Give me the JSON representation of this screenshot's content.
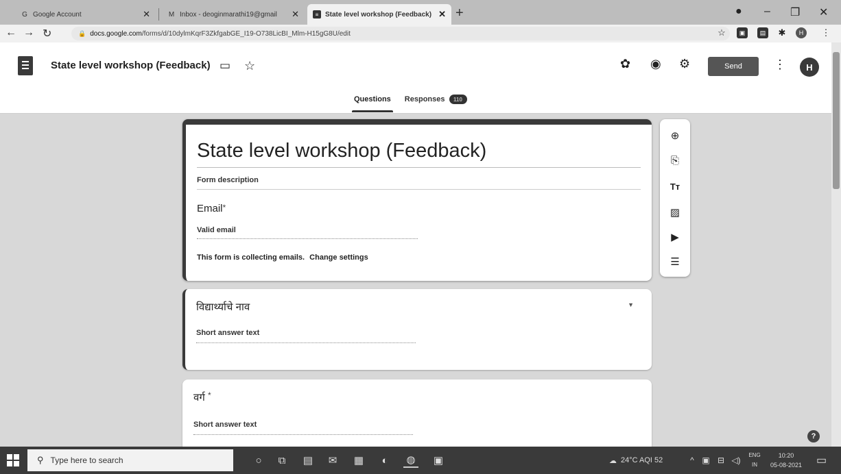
{
  "browser": {
    "tabs": [
      {
        "title": "Google Account",
        "favicon": "G"
      },
      {
        "title": "Inbox - deoginmarathi19@gmail",
        "favicon": "M"
      },
      {
        "title": "State level workshop (Feedback)",
        "favicon": "≡"
      }
    ],
    "url_host": "docs.google.com",
    "url_path": "/forms/d/10dylmKqrF3ZkfgabGE_I19-O738LicBI_Mlm-H15gG8U/edit",
    "profile_initial": "H"
  },
  "forms_header": {
    "title": "State level workshop (Feedback)",
    "send_label": "Send",
    "avatar_initial": "H",
    "tab_questions": "Questions",
    "tab_responses": "Responses",
    "responses_count": "110"
  },
  "form": {
    "title": "State level workshop (Feedback)",
    "description_placeholder": "Form description",
    "email_question": "Email",
    "required_mark": "*",
    "email_hint": "Valid email",
    "collecting_text": "This form is collecting emails.",
    "change_settings": "Change settings",
    "questions": [
      {
        "title": "विद्यार्थ्याचे नाव",
        "hint": "Short answer text"
      },
      {
        "title": "वर्ग",
        "required_mark": "*",
        "hint": "Short answer text"
      }
    ]
  },
  "toolbar_icons": [
    "add-question-icon",
    "import-questions-icon",
    "add-title-icon",
    "add-image-icon",
    "add-video-icon",
    "add-section-icon"
  ],
  "taskbar": {
    "search_placeholder": "Type here to search",
    "weather": "24°C  AQI 52",
    "lang_top": "ENG",
    "lang_bottom": "IN",
    "time": "10:20",
    "date": "05-08-2021"
  }
}
